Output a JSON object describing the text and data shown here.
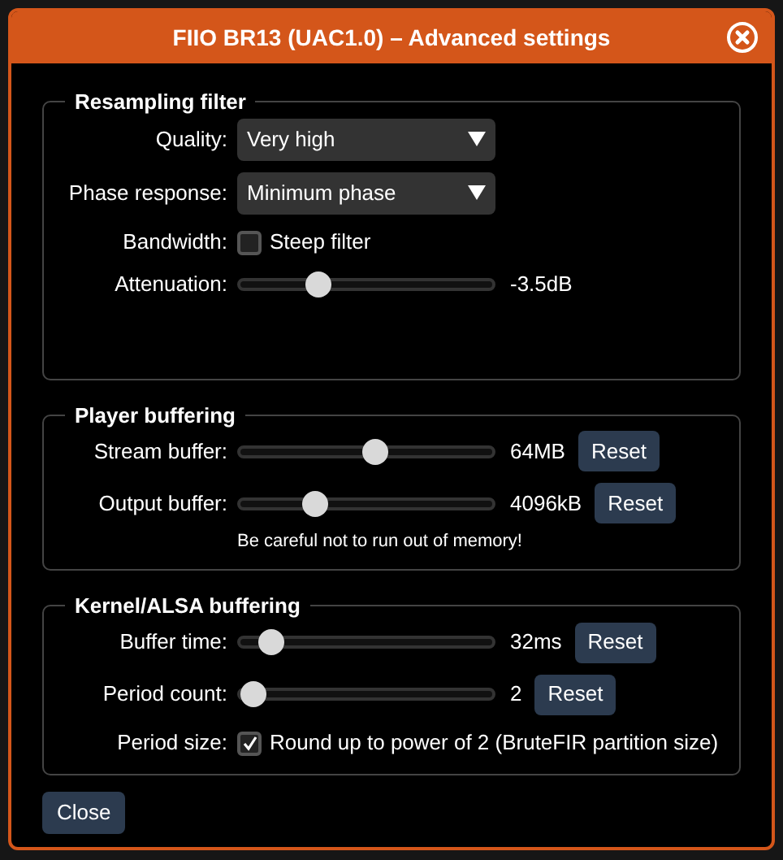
{
  "window": {
    "title": "FIIO BR13 (UAC1.0) – Advanced settings"
  },
  "sections": [
    {
      "legend": "Resampling filter",
      "rows": [
        {
          "kind": "select",
          "label": "Quality:",
          "value": "Very high"
        },
        {
          "kind": "select",
          "label": "Phase response:",
          "value": "Minimum phase"
        },
        {
          "kind": "checkbox",
          "label": "Bandwidth:",
          "text": "Steep filter",
          "checked": false
        },
        {
          "kind": "slider",
          "label": "Attenuation:",
          "level": 0.29,
          "reading": "-3.5dB"
        }
      ]
    },
    {
      "legend": "Player buffering",
      "rows": [
        {
          "kind": "slider",
          "label": "Stream buffer:",
          "level": 0.54,
          "reading": "64MB",
          "reset": "Reset"
        },
        {
          "kind": "slider",
          "label": "Output buffer:",
          "level": 0.27,
          "reading": "4096kB",
          "reset": "Reset"
        },
        {
          "kind": "note",
          "text": "Be careful not to run out of memory!"
        }
      ]
    },
    {
      "legend": "Kernel/ALSA buffering",
      "rows": [
        {
          "kind": "slider",
          "label": "Buffer time:",
          "level": 0.08,
          "reading": "32ms",
          "reset": "Reset"
        },
        {
          "kind": "slider",
          "label": "Period count:",
          "level": 0,
          "reading": "2",
          "reset": "Reset"
        },
        {
          "kind": "checkbox",
          "label": "Period size:",
          "text": "Round up to power of 2 (BruteFIR partition size)",
          "checked": true
        }
      ]
    }
  ],
  "close_button": {
    "label": "Close"
  }
}
